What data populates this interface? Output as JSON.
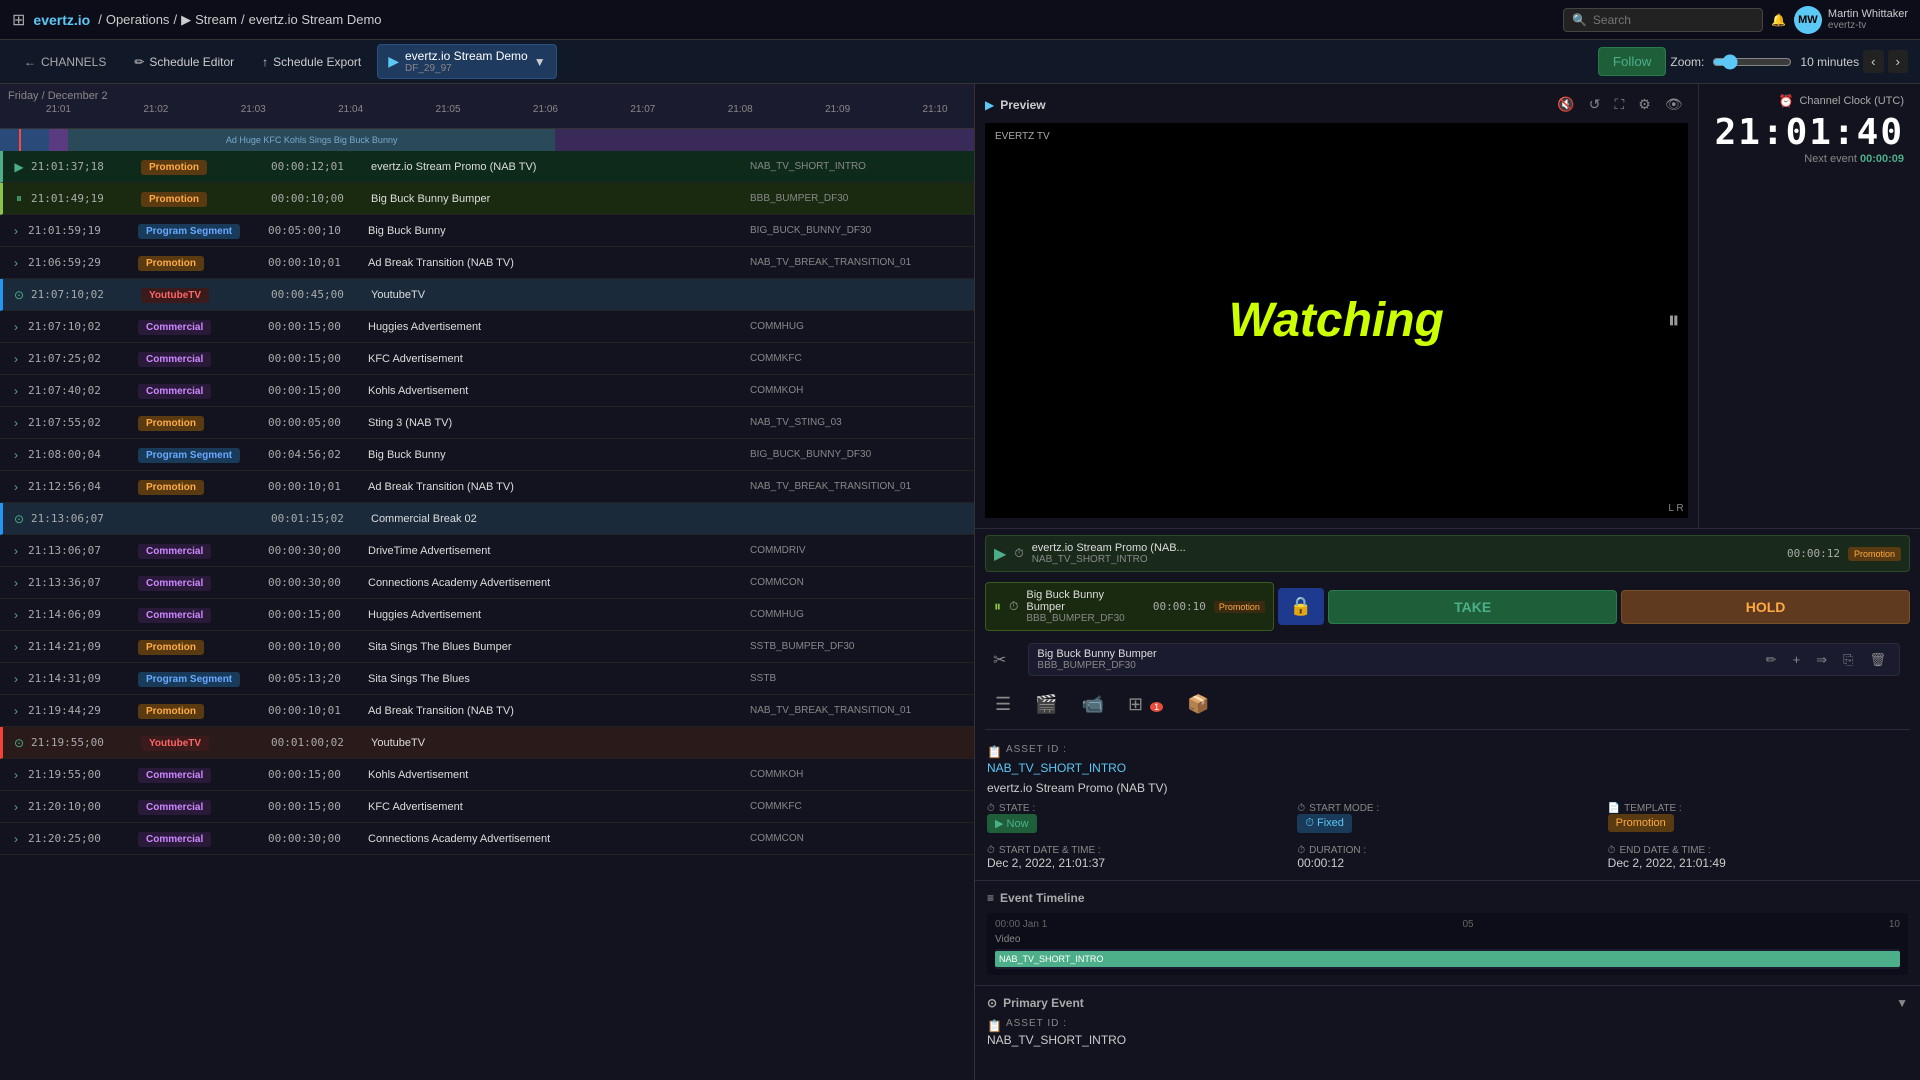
{
  "app": {
    "grid_icon": "⊞",
    "logo": "evertz.io",
    "breadcrumb": [
      "Operations",
      "Stream",
      "evertz.io Stream Demo"
    ],
    "search_placeholder": "Search"
  },
  "toolbar": {
    "channels_label": "CHANNELS",
    "schedule_editor_label": "Schedule Editor",
    "schedule_export_label": "Schedule Export",
    "channel_name": "evertz.io Stream Demo",
    "channel_sub": "DF_29_97",
    "follow_label": "Follow",
    "zoom_label": "Zoom:",
    "zoom_value": "10 minutes"
  },
  "timeline": {
    "date": "Friday / December 2",
    "times": [
      "21:01",
      "21:02",
      "21:03",
      "21:04",
      "21:05",
      "21:06",
      "21:07",
      "21:08",
      "21:09",
      "21:10"
    ]
  },
  "schedule": {
    "rows": [
      {
        "indicator": "▶",
        "time": "21:01:37;18",
        "type": "Promotion",
        "duration": "00:00:12;01",
        "title": "evertz.io Stream Promo (NAB TV)",
        "asset": "NAB_TV_SHORT_INTRO",
        "rowClass": "playing"
      },
      {
        "indicator": "⏸",
        "time": "21:01:49;19",
        "type": "Promotion",
        "duration": "00:00:10;00",
        "title": "Big Buck Bunny Bumper",
        "asset": "BBB_BUMPER_DF30",
        "rowClass": "paused"
      },
      {
        "indicator": "",
        "time": "21:01:59;19",
        "type": "Program Segment",
        "duration": "00:05:00;10",
        "title": "Big Buck Bunny",
        "asset": "BIG_BUCK_BUNNY_DF30",
        "rowClass": ""
      },
      {
        "indicator": "",
        "time": "21:06:59;29",
        "type": "Promotion",
        "duration": "00:00:10;01",
        "title": "Ad Break Transition (NAB TV)",
        "asset": "NAB_TV_BREAK_TRANSITION_01",
        "rowClass": ""
      },
      {
        "indicator": "⊙",
        "time": "21:07:10;02",
        "type": "YoutubeTV",
        "duration": "00:00:45;00",
        "title": "YoutubeTV",
        "asset": "",
        "rowClass": "block-header"
      },
      {
        "indicator": "›",
        "time": "21:07:10;02",
        "type": "Commercial",
        "duration": "00:00:15;00",
        "title": "Huggies Advertisement",
        "asset": "COMMHUG",
        "rowClass": ""
      },
      {
        "indicator": "›",
        "time": "21:07:25;02",
        "type": "Commercial",
        "duration": "00:00:15;00",
        "title": "KFC Advertisement",
        "asset": "COMMKFC",
        "rowClass": ""
      },
      {
        "indicator": "›",
        "time": "21:07:40;02",
        "type": "Commercial",
        "duration": "00:00:15;00",
        "title": "Kohls Advertisement",
        "asset": "COMMKOH",
        "rowClass": ""
      },
      {
        "indicator": "›",
        "time": "21:07:55;02",
        "type": "Promotion",
        "duration": "00:00:05;00",
        "title": "Sting 3 (NAB TV)",
        "asset": "NAB_TV_STING_03",
        "rowClass": ""
      },
      {
        "indicator": "›",
        "time": "21:08:00;04",
        "type": "Program Segment",
        "duration": "00:04:56;02",
        "title": "Big Buck Bunny",
        "asset": "BIG_BUCK_BUNNY_DF30",
        "rowClass": ""
      },
      {
        "indicator": "›",
        "time": "21:12:56;04",
        "type": "Promotion",
        "duration": "00:00:10;01",
        "title": "Ad Break Transition (NAB TV)",
        "asset": "NAB_TV_BREAK_TRANSITION_01",
        "rowClass": ""
      },
      {
        "indicator": "⊙",
        "time": "21:13:06;07",
        "type": "",
        "duration": "00:01:15;02",
        "title": "Commercial Break 02",
        "asset": "",
        "rowClass": "block-header"
      },
      {
        "indicator": "›",
        "time": "21:13:06;07",
        "type": "Commercial",
        "duration": "00:00:30;00",
        "title": "DriveTime Advertisement",
        "asset": "COMMDRIV",
        "rowClass": ""
      },
      {
        "indicator": "›",
        "time": "21:13:36;07",
        "type": "Commercial",
        "duration": "00:00:30;00",
        "title": "Connections Academy Advertisement",
        "asset": "COMMCON",
        "rowClass": ""
      },
      {
        "indicator": "›",
        "time": "21:14:06;09",
        "type": "Commercial",
        "duration": "00:00:15;00",
        "title": "Huggies Advertisement",
        "asset": "COMMHUG",
        "rowClass": ""
      },
      {
        "indicator": "›",
        "time": "21:14:21;09",
        "type": "Promotion",
        "duration": "00:00:10;00",
        "title": "Sita Sings The Blues Bumper",
        "asset": "SSTB_BUMPER_DF30",
        "rowClass": ""
      },
      {
        "indicator": "›",
        "time": "21:14:31;09",
        "type": "Program Segment",
        "duration": "00:05:13;20",
        "title": "Sita Sings The Blues",
        "asset": "SSTB",
        "rowClass": ""
      },
      {
        "indicator": "›",
        "time": "21:19:44;29",
        "type": "Promotion",
        "duration": "00:00:10;01",
        "title": "Ad Break Transition (NAB TV)",
        "asset": "NAB_TV_BREAK_TRANSITION_01",
        "rowClass": ""
      },
      {
        "indicator": "⊙",
        "time": "21:19:55;00",
        "type": "YoutubeTV",
        "duration": "00:01:00;02",
        "title": "YoutubeTV",
        "asset": "",
        "rowClass": "block-header-red"
      },
      {
        "indicator": "›",
        "time": "21:19:55;00",
        "type": "Commercial",
        "duration": "00:00:15;00",
        "title": "Kohls Advertisement",
        "asset": "COMMKOH",
        "rowClass": ""
      },
      {
        "indicator": "›",
        "time": "21:20:10;00",
        "type": "Commercial",
        "duration": "00:00:15;00",
        "title": "KFC Advertisement",
        "asset": "COMMKFC",
        "rowClass": ""
      },
      {
        "indicator": "›",
        "time": "21:20:25;00",
        "type": "Commercial",
        "duration": "00:00:30;00",
        "title": "Connections Academy Advertisement",
        "asset": "COMMCON",
        "rowClass": ""
      }
    ]
  },
  "right_panel": {
    "preview_label": "Preview",
    "watching_text": "Watching",
    "lr_text": "L R",
    "clock_label": "Channel Clock (UTC)",
    "clock_time": "21:01:40",
    "next_event_label": "Next event",
    "next_event_time": "00:00:09",
    "now_playing": {
      "title": "evertz.io Stream Promo (NAB...",
      "asset": "NAB_TV_SHORT_INTRO",
      "duration": "00:00:12",
      "badge": "Promotion"
    },
    "paused": {
      "title": "Big Buck Bunny Bumper",
      "asset": "BBB_BUMPER_DF30",
      "duration": "00:00:10",
      "badge": "Promotion"
    },
    "edit_row": {
      "title": "Big Buck Bunny Bumper",
      "asset": "BBB_BUMPER_DF30"
    },
    "take_label": "TAKE",
    "hold_label": "HOLD",
    "asset_id_label": "ASSET ID :",
    "asset_id_value": "NAB_TV_SHORT_INTRO",
    "asset_title": "evertz.io Stream Promo (NAB TV)",
    "state_label": "STATE :",
    "state_value": "Now",
    "start_mode_label": "START MODE :",
    "start_mode_value": "Fixed",
    "template_label": "TEMPLATE :",
    "template_value": "Promotion",
    "start_date_label": "START DATE & TIME :",
    "start_date_value": "Dec 2, 2022, 21:01:37",
    "duration_label": "DURATION :",
    "duration_value": "00:00:12",
    "end_date_label": "END DATE & TIME :",
    "end_date_value": "Dec 2, 2022, 21:01:49",
    "event_timeline_label": "Event Timeline",
    "timeline_labels": [
      "00:00 Jan 1",
      "05",
      "10"
    ],
    "timeline_segment": "NAB_TV_SHORT_INTRO",
    "primary_event_label": "Primary Event",
    "primary_asset_id_label": "ASSET ID :",
    "primary_asset_id_value": "NAB_TV_SHORT_INTRO"
  }
}
